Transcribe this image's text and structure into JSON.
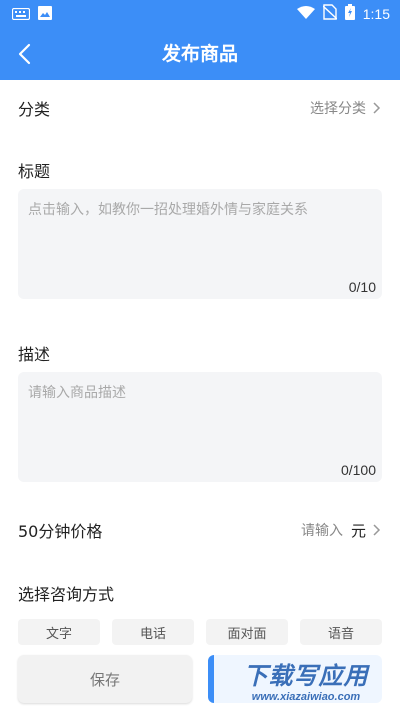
{
  "status_bar": {
    "time": "1:15"
  },
  "app_bar": {
    "title": "发布商品"
  },
  "category": {
    "label": "分类",
    "value": "选择分类"
  },
  "title_field": {
    "label": "标题",
    "placeholder": "点击输入，如教你一招处理婚外情与家庭关系",
    "counter": "0/10"
  },
  "description_field": {
    "label": "描述",
    "placeholder": "请输入商品描述",
    "counter": "0/100"
  },
  "price": {
    "label": "50分钟价格",
    "placeholder": "请输入",
    "unit": "元"
  },
  "consult": {
    "label": "选择咨询方式",
    "options": [
      "文字",
      "电话",
      "面对面",
      "语音"
    ]
  },
  "actions": {
    "save_label": "保存"
  },
  "watermark": {
    "main": "下载写应用",
    "sub": "www.xiazaiwiao.com"
  },
  "colors": {
    "primary": "#3c8ef7",
    "input_bg": "#f4f5f7",
    "chip_bg": "#f3f3f3"
  }
}
